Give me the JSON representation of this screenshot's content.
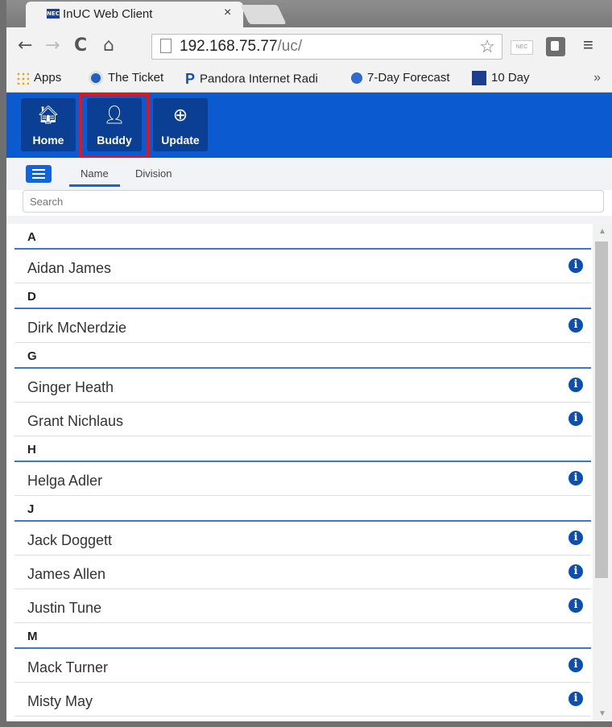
{
  "browser": {
    "tab_title": "InUC Web Client",
    "tab_favicon_text": "NEC",
    "tab_close": "×",
    "url_host": "192.168.75.77",
    "url_path": "/uc/",
    "ext1_label": "NEC",
    "bookmarks": [
      "Apps",
      "The Ticket",
      "Pandora Internet Radi",
      "7-Day Forecast",
      "10 Day"
    ],
    "more_bookmarks": "»"
  },
  "app": {
    "nav": [
      {
        "label": "Home",
        "icon": "home-icon"
      },
      {
        "label": "Buddy",
        "icon": "person-icon"
      },
      {
        "label": "Update",
        "icon": "download-icon"
      }
    ],
    "highlighted_button": "Buddy",
    "accent_color": "#0b5ad0",
    "filter_tabs": [
      "Name",
      "Division"
    ],
    "active_filter": "Name",
    "search_placeholder": "Search"
  },
  "buddy_list": [
    {
      "letter": "A",
      "names": [
        "Aidan James"
      ]
    },
    {
      "letter": "D",
      "names": [
        "Dirk McNerdzie"
      ]
    },
    {
      "letter": "G",
      "names": [
        "Ginger Heath",
        "Grant Nichlaus"
      ]
    },
    {
      "letter": "H",
      "names": [
        "Helga Adler"
      ]
    },
    {
      "letter": "J",
      "names": [
        "Jack Doggett",
        "James Allen",
        "Justin Tune"
      ]
    },
    {
      "letter": "M",
      "names": [
        "Mack Turner",
        "Misty May"
      ]
    }
  ]
}
